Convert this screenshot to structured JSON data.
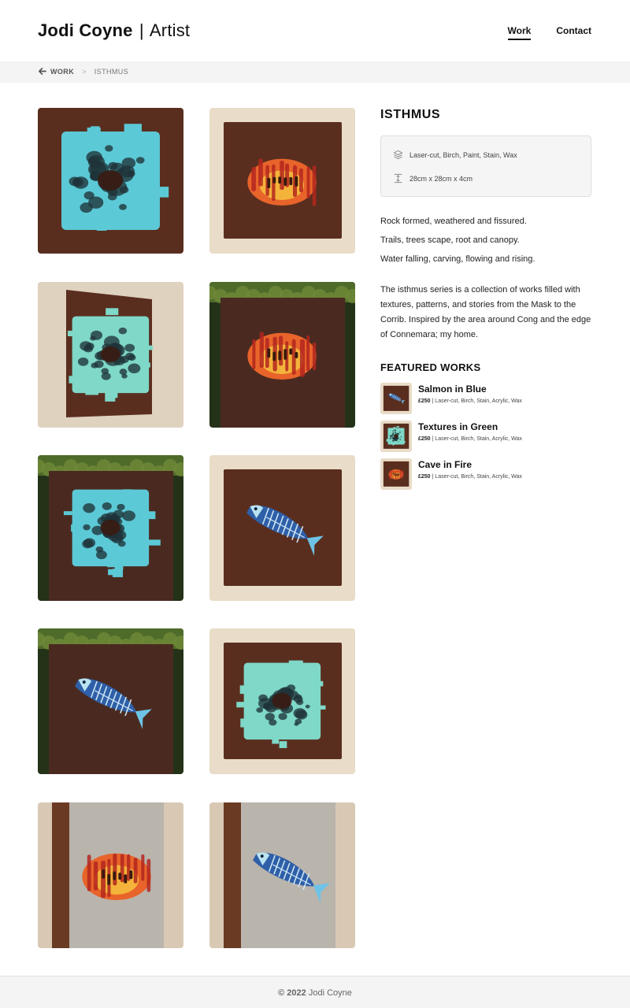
{
  "header": {
    "brand_name": "Jodi Coyne",
    "brand_separator": "|",
    "brand_role": "Artist",
    "nav": [
      {
        "label": "Work",
        "active": true
      },
      {
        "label": "Contact",
        "active": false
      }
    ]
  },
  "breadcrumb": {
    "back_icon": "arrow-left-icon",
    "parent": "WORK",
    "separator": ">",
    "current": "ISTHMUS"
  },
  "gallery": {
    "images": [
      {
        "subject": "Textures in Blue",
        "variant": "flat"
      },
      {
        "subject": "Cave in Fire",
        "variant": "frame"
      },
      {
        "subject": "Textures in Green",
        "variant": "angled"
      },
      {
        "subject": "Cave in Fire",
        "variant": "moss"
      },
      {
        "subject": "Textures in Blue",
        "variant": "moss"
      },
      {
        "subject": "Salmon in Blue",
        "variant": "frame"
      },
      {
        "subject": "Salmon in Blue",
        "variant": "moss"
      },
      {
        "subject": "Textures in Green",
        "variant": "frame"
      },
      {
        "subject": "Cave in Fire",
        "variant": "edge"
      },
      {
        "subject": "Salmon in Blue",
        "variant": "edge"
      }
    ]
  },
  "detail": {
    "title": "ISTHMUS",
    "specs": {
      "materials_icon": "layers-icon",
      "materials": "Laser-cut, Birch, Paint, Stain, Wax",
      "dimensions_icon": "height-icon",
      "dimensions": "28cm x 28cm x 4cm"
    },
    "poem": [
      "Rock formed, weathered and fissured.",
      "Trails, trees scape, root and canopy.",
      "Water falling, carving, flowing and rising."
    ],
    "description": "The isthmus series is a collection of works filled with textures, patterns, and stories from the Mask to the Corrib. Inspired by the area around Cong and the edge of Connemara; my home."
  },
  "featured": {
    "heading": "FEATURED WORKS",
    "items": [
      {
        "name": "Salmon in Blue",
        "price": "£250",
        "meta": "Laser-cut, Birch, Stain, Acrylic, Wax",
        "thumb": "salmon"
      },
      {
        "name": "Textures in Green",
        "price": "£250",
        "meta": "Laser-cut, Birch, Stain, Acrylic, Wax",
        "thumb": "textures"
      },
      {
        "name": "Cave in Fire",
        "price": "£250",
        "meta": "Laser-cut, Birch, Stain, Acrylic, Wax",
        "thumb": "cave"
      }
    ]
  },
  "footer": {
    "copyright": "© 2022",
    "owner": "Jodi Coyne"
  },
  "colors": {
    "wood": "#5a2e1f",
    "wood_dark": "#3b1a10",
    "turquoise": "#5cc9d6",
    "mint": "#7fd8c8",
    "fire_orange": "#e8642a",
    "fire_yellow": "#f4b33a",
    "salmon_blue": "#2f5fa8",
    "wall_beige": "#e9dcc8",
    "moss_green": "#4f6b2a"
  }
}
